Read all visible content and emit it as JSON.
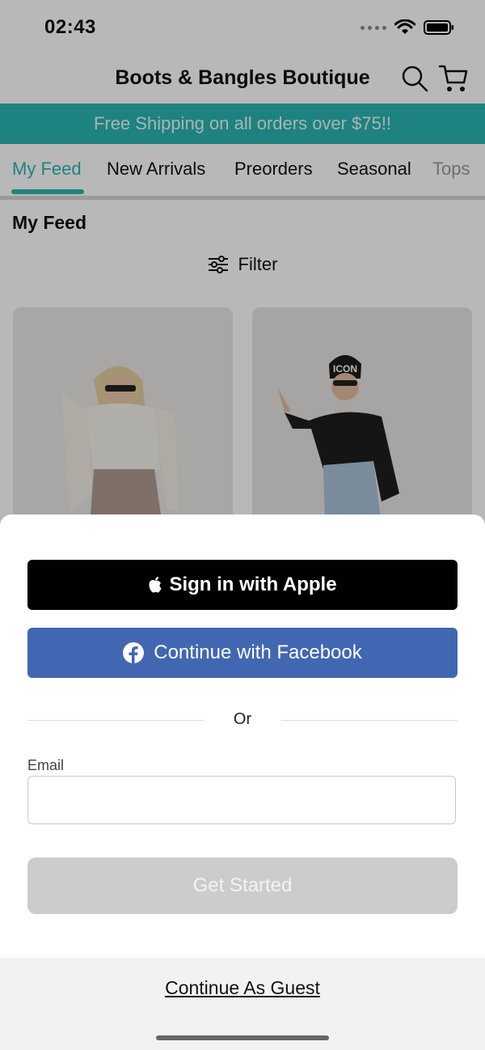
{
  "status_bar": {
    "time": "02:43"
  },
  "header": {
    "title": "Boots & Bangles Boutique",
    "search_icon": "search-icon",
    "cart_icon": "cart-icon"
  },
  "banner": {
    "text": "Free Shipping on all orders over $75!!"
  },
  "tabs": [
    {
      "label": "My Feed",
      "active": true
    },
    {
      "label": "New Arrivals",
      "active": false
    },
    {
      "label": "Preorders",
      "active": false
    },
    {
      "label": "Seasonal",
      "active": false
    },
    {
      "label": "Tops",
      "active": false
    }
  ],
  "feed": {
    "title": "My Feed",
    "filter_label": "Filter"
  },
  "sheet": {
    "apple_label": "Sign in with Apple",
    "facebook_label": "Continue with Facebook",
    "or_text": "Or",
    "email_label": "Email",
    "email_value": "",
    "email_placeholder": "",
    "get_started_label": "Get Started",
    "guest_label": "Continue As Guest"
  },
  "colors": {
    "accent": "#2ab5b2",
    "facebook": "#4267b2",
    "apple": "#000000",
    "disabled": "#cccccc"
  }
}
